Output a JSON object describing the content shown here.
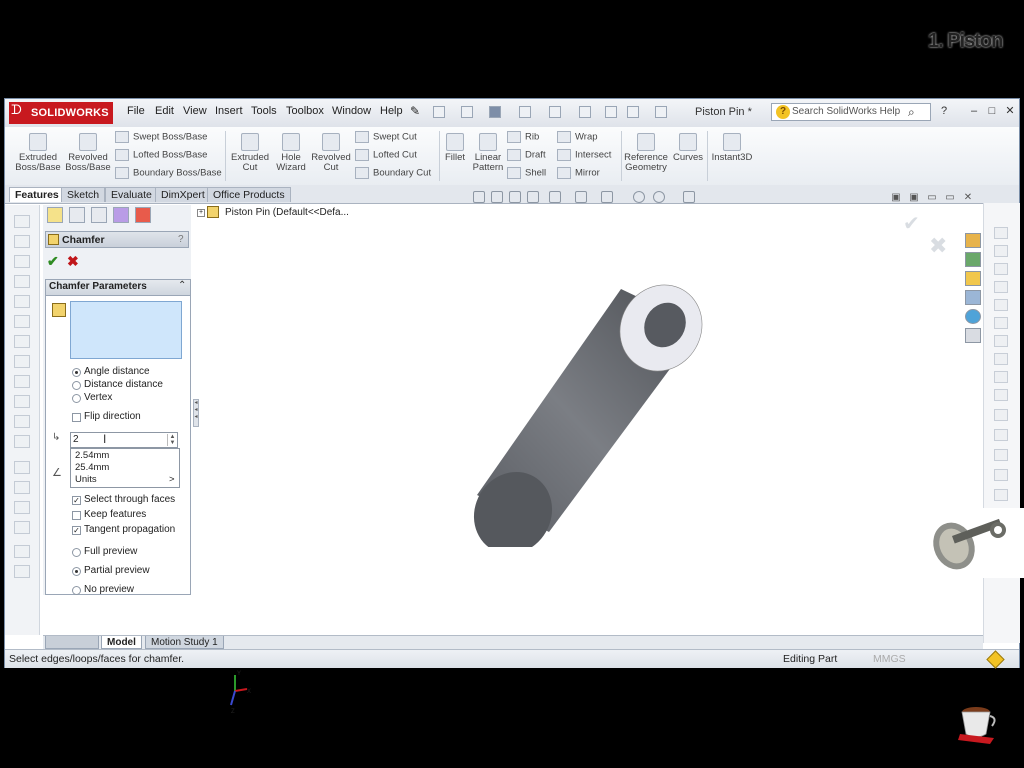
{
  "app": {
    "logo": "SOLIDWORKS",
    "menus": [
      "File",
      "Edit",
      "View",
      "Insert",
      "Tools",
      "Toolbox",
      "Window",
      "Help"
    ],
    "document_title": "Piston Pin *",
    "search_placeholder": "Search SolidWorks Help",
    "window_buttons": [
      "?",
      "–",
      "□",
      "✕"
    ]
  },
  "overlay_title": "1. Piston",
  "command_manager": {
    "large": [
      {
        "label1": "Extruded",
        "label2": "Boss/Base",
        "icon": "extruded-boss-icon"
      },
      {
        "label1": "Revolved",
        "label2": "Boss/Base",
        "icon": "revolved-boss-icon"
      },
      {
        "label1": "Extruded",
        "label2": "Cut",
        "icon": "extruded-cut-icon"
      },
      {
        "label1": "Hole",
        "label2": "Wizard",
        "icon": "hole-wizard-icon"
      },
      {
        "label1": "Revolved",
        "label2": "Cut",
        "icon": "revolved-cut-icon"
      },
      {
        "label1": "Fillet",
        "label2": "",
        "icon": "fillet-icon"
      },
      {
        "label1": "Linear",
        "label2": "Pattern",
        "icon": "linear-pattern-icon"
      },
      {
        "label1": "Reference",
        "label2": "Geometry",
        "icon": "reference-geometry-icon"
      },
      {
        "label1": "Curves",
        "label2": "",
        "icon": "curves-icon"
      },
      {
        "label1": "Instant3D",
        "label2": "",
        "icon": "instant3d-icon"
      }
    ],
    "small_boss": [
      "Swept Boss/Base",
      "Lofted Boss/Base",
      "Boundary Boss/Base"
    ],
    "small_cut": [
      "Swept Cut",
      "Lofted Cut",
      "Boundary Cut"
    ],
    "small_features": [
      "Rib",
      "Draft",
      "Shell"
    ],
    "small_features2": [
      "Wrap",
      "Intersect",
      "Mirror"
    ]
  },
  "tabs": [
    "Features",
    "Sketch",
    "Evaluate",
    "DimXpert",
    "Office Products"
  ],
  "property_manager": {
    "title": "Chamfer",
    "help": "?",
    "group_title": "Chamfer Parameters",
    "collapse": "⌃",
    "radios": [
      "Angle distance",
      "Distance distance",
      "Vertex"
    ],
    "flip_label": "Flip direction",
    "distance_value": "2",
    "dropdown": [
      "2.54mm",
      "25.4mm",
      "Units"
    ],
    "dropdown_more": ">",
    "checks": [
      {
        "label": "Select through faces",
        "checked": true
      },
      {
        "label": "Keep features",
        "checked": false
      },
      {
        "label": "Tangent propagation",
        "checked": true
      }
    ],
    "preview": [
      "Full preview",
      "Partial preview",
      "No preview"
    ]
  },
  "graphics": {
    "tree_label": "Piston Pin  (Default<<Defa..."
  },
  "bottom_tabs": [
    "Model",
    "Motion Study 1"
  ],
  "status": {
    "message": "Select edges/loops/faces for chamfer.",
    "mode": "Editing Part",
    "units": "MMGS"
  }
}
